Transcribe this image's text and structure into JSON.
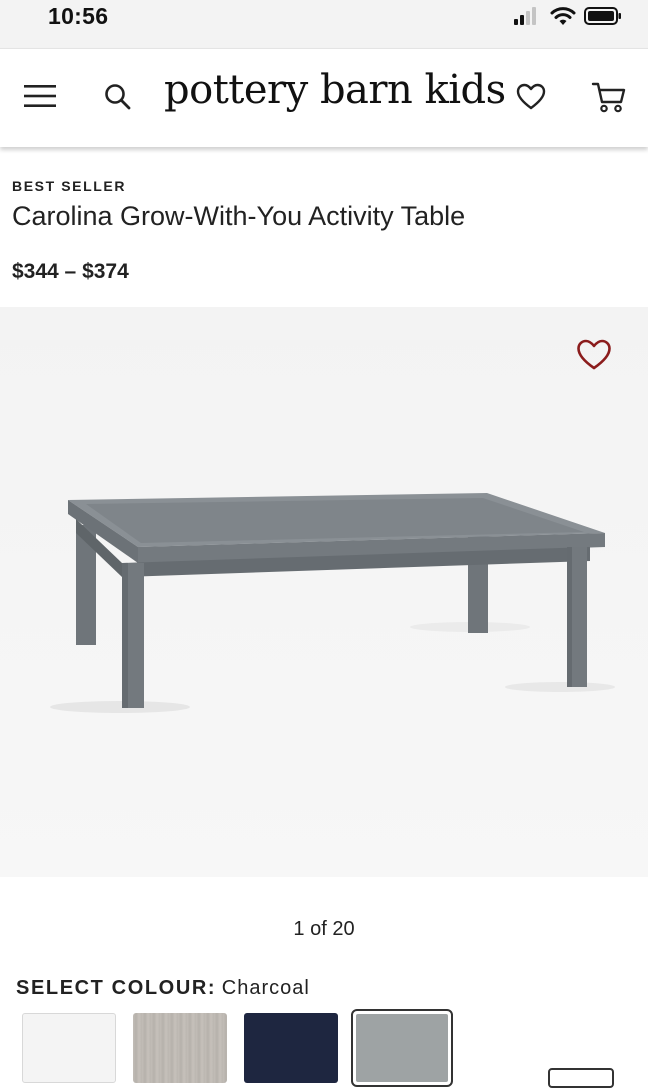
{
  "status_bar": {
    "time": "10:56"
  },
  "header": {
    "brand": "pottery barn kids",
    "menu_icon": "hamburger-menu-icon",
    "search_icon": "search-icon",
    "wishlist_icon": "heart-icon",
    "cart_icon": "cart-icon"
  },
  "product": {
    "badge": "BEST SELLER",
    "title": "Carolina Grow-With-You Activity Table",
    "price": "$344 – $374"
  },
  "gallery": {
    "counter": "1 of 20",
    "favorite_icon": "heart-outline-icon"
  },
  "colour": {
    "label": "SELECT COLOUR:",
    "selected": "Charcoal",
    "swatches": [
      {
        "color": "#f4f4f4"
      },
      {
        "color": "#bcb7b1"
      },
      {
        "color": "#1e2640"
      },
      {
        "color": "#9ea3a4"
      }
    ]
  },
  "colors": {
    "accent": "#8b1c1c",
    "table": "#7d8388"
  }
}
